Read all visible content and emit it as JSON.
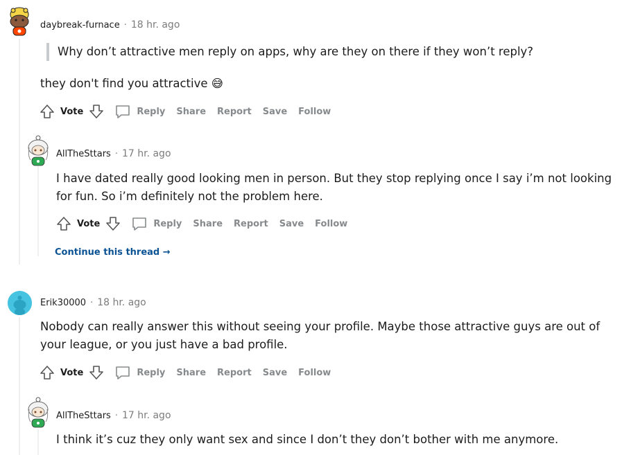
{
  "comments": [
    {
      "author": "daybreak-furnace",
      "sep": "·",
      "time": "18 hr. ago",
      "quote": "Why don’t attractive men reply on apps, why are they on there if they won’t reply?",
      "body": "they don't find you attractive 😅",
      "actions": {
        "vote": "Vote",
        "reply": "Reply",
        "share": "Share",
        "report": "Report",
        "save": "Save",
        "follow": "Follow"
      }
    },
    {
      "author": "AllTheSttars",
      "sep": "·",
      "time": "17 hr. ago",
      "body": "I have dated really good looking men in person. But they stop replying once I say i’m not looking for fun. So i’m definitely not the problem here.",
      "actions": {
        "vote": "Vote",
        "reply": "Reply",
        "share": "Share",
        "report": "Report",
        "save": "Save",
        "follow": "Follow"
      },
      "continue": "Continue this thread →"
    },
    {
      "author": "Erik30000",
      "sep": "·",
      "time": "18 hr. ago",
      "body": "Nobody can really answer this without seeing your profile. Maybe those attractive guys are out of your league, or you just have a bad profile.",
      "actions": {
        "vote": "Vote",
        "reply": "Reply",
        "share": "Share",
        "report": "Report",
        "save": "Save",
        "follow": "Follow"
      }
    },
    {
      "author": "AllTheSttars",
      "sep": "·",
      "time": "17 hr. ago",
      "body": "I think it’s cuz they only want sex and since I don’t they don’t bother with me anymore."
    }
  ],
  "colors": {
    "muted": "#878a8c",
    "link": "#0b5394",
    "thread": "#edeff1",
    "erik_avatar": "#46c3e0"
  },
  "icons": [
    "upvote-icon",
    "downvote-icon",
    "comment-bubble-icon",
    "snoo-avatar-icon"
  ]
}
